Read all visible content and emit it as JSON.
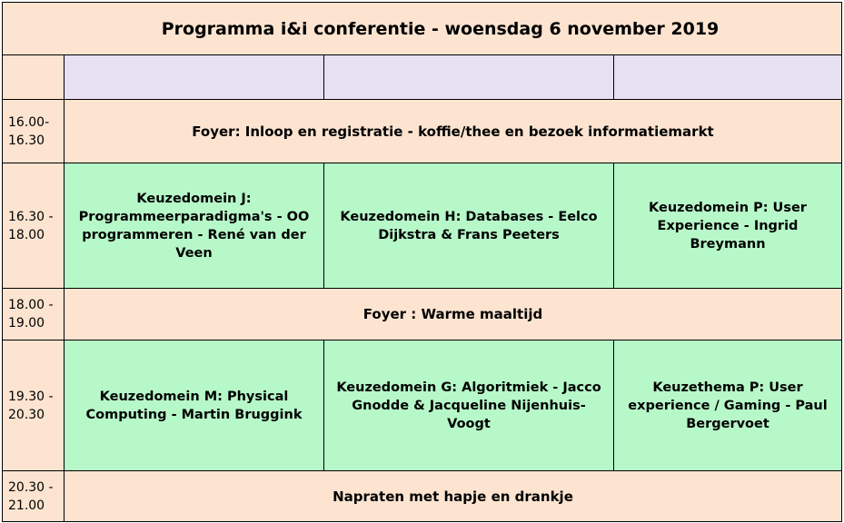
{
  "title": "Programma i&i conferentie  - woensdag 6 november 2019",
  "rows": [
    {
      "time": "16.00-\n16.30",
      "text": "Foyer: Inloop en registratie - koffie/thee en bezoek informatiemarkt"
    },
    {
      "time": "16.30 -\n18.00",
      "sessions": [
        "Keuzedomein J: Programmeerparadigma's - OO programmeren - René van der Veen",
        "Keuzedomein H: Databases - Eelco Dijkstra & Frans Peeters",
        "Keuzedomein P: User Experience - Ingrid Breymann"
      ]
    },
    {
      "time": "18.00 -\n19.00",
      "text": "Foyer : Warme maaltijd"
    },
    {
      "time": "19.30 -\n20.30",
      "sessions": [
        "Keuzedomein M:  Physical Computing - Martin Bruggink",
        "Keuzedomein G: Algoritmiek - Jacco Gnodde & Jacqueline Nijenhuis-Voogt",
        "Keuzethema P: User experience / Gaming - Paul Bergervoet"
      ]
    },
    {
      "time": "20.30 -\n21.00",
      "text": "Napraten met hapje en drankje"
    }
  ]
}
